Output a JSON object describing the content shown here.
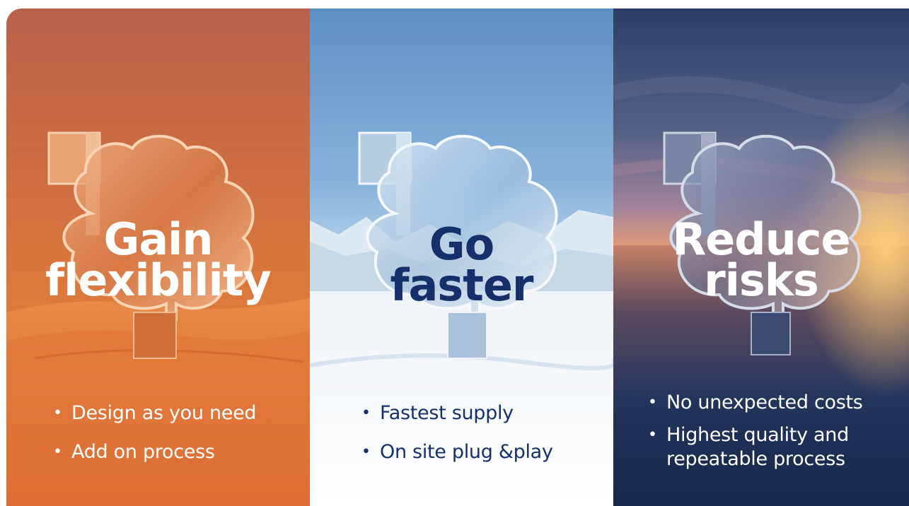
{
  "panels": [
    {
      "title_line1": "Gain",
      "title_line2": "flexibility",
      "bullets": [
        "Design as you need",
        "Add on process"
      ]
    },
    {
      "title_line1": "Go",
      "title_line2": "faster",
      "bullets": [
        "Fastest supply",
        "On site plug &play"
      ]
    },
    {
      "title_line1": "Reduce",
      "title_line2": "risks",
      "bullets": [
        "No unexpected costs",
        "Highest quality and repeatable process"
      ]
    }
  ],
  "colors": {
    "desert": "#d96f3c",
    "snow_sky": "#6f9fd0",
    "ocean_sky": "#3b4a6e",
    "navy_text": "#15306b"
  },
  "icons": [
    "cloud-sculpture-icon"
  ]
}
